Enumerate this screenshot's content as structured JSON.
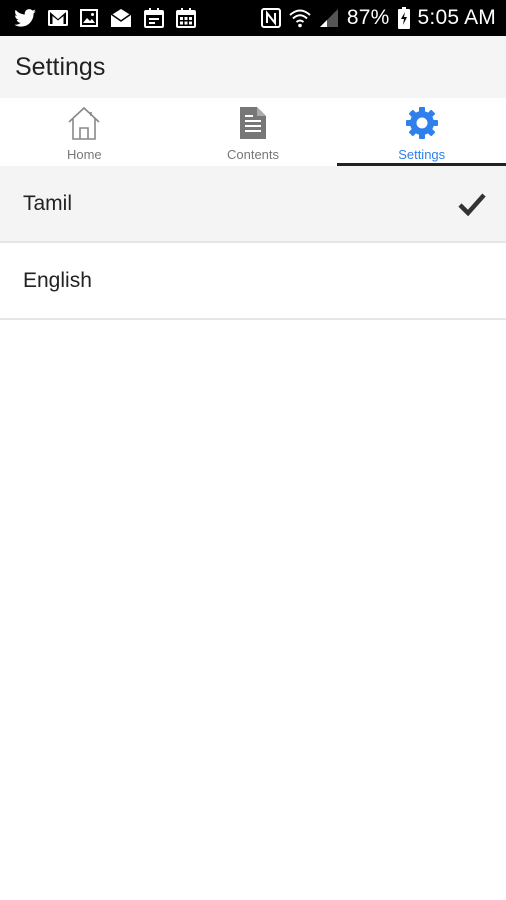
{
  "status_bar": {
    "battery": "87%",
    "time": "5:05 AM",
    "left_icons": [
      "twitter-icon",
      "gmail-icon",
      "gallery-icon",
      "mail-icon",
      "calendar-icon",
      "calendar-grid-icon"
    ],
    "right_icons": [
      "nfc-icon",
      "wifi-icon",
      "signal-icon",
      "battery-charging-icon"
    ]
  },
  "app_bar": {
    "title": "Settings"
  },
  "tabs": [
    {
      "label": "Home",
      "icon": "home-icon",
      "active": false
    },
    {
      "label": "Contents",
      "icon": "document-icon",
      "active": false
    },
    {
      "label": "Settings",
      "icon": "gear-icon",
      "active": true
    }
  ],
  "languages": [
    {
      "label": "Tamil",
      "selected": true
    },
    {
      "label": "English",
      "selected": false
    }
  ],
  "colors": {
    "accent": "#2f80ed",
    "status_bar": "#000000",
    "app_bar": "#f5f5f5",
    "selected_row": "#f4f4f4",
    "indicator": "#222222"
  }
}
